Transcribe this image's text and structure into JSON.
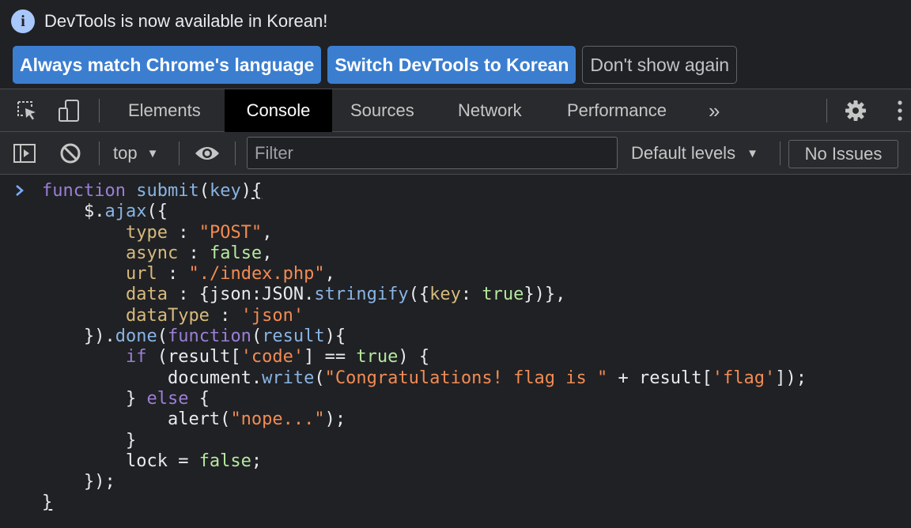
{
  "infobar": {
    "message": "DevTools is now available in Korean!",
    "buttons": {
      "match_language": "Always match Chrome's language",
      "switch_korean": "Switch DevTools to Korean",
      "dont_show": "Don't show again"
    }
  },
  "tabs": {
    "elements": "Elements",
    "console": "Console",
    "sources": "Sources",
    "network": "Network",
    "performance": "Performance",
    "more": "»"
  },
  "console_toolbar": {
    "context": "top",
    "filter_placeholder": "Filter",
    "levels": "Default levels",
    "issues": "No Issues"
  },
  "code": {
    "l1": {
      "kw": "function",
      "name": "submit",
      "open": "(",
      "param": "key",
      "close": ")",
      "brace": "{"
    },
    "l2": {
      "indent": "    ",
      "obj": "$.",
      "method": "ajax",
      "rest": "({"
    },
    "l3": {
      "indent": "        ",
      "key": "type",
      "sep": " : ",
      "value": "\"POST\"",
      "end": ","
    },
    "l4": {
      "indent": "        ",
      "key": "async",
      "sep": " : ",
      "value": "false",
      "end": ","
    },
    "l5": {
      "indent": "        ",
      "key": "url",
      "sep": " : ",
      "value": "\"./index.php\"",
      "end": ","
    },
    "l6": {
      "indent": "        ",
      "key": "data",
      "sep": " : {json:JSON.",
      "method": "stringify",
      "open": "({",
      "key2": "key",
      "colon": ": ",
      "value": "true",
      "end": "})},"
    },
    "l7": {
      "indent": "        ",
      "key": "dataType",
      "sep": " : ",
      "value": "'json'"
    },
    "l8": {
      "indent": "    ",
      "start": "}).",
      "method": "done",
      "open": "(",
      "kw": "function",
      "paren": "(",
      "param": "result",
      "end": "){"
    },
    "l9": {
      "indent": "        ",
      "kw": "if",
      "start": " (result[",
      "value": "'code'",
      "mid": "] == ",
      "lit": "true",
      "end": ") {"
    },
    "l10": {
      "indent": "            ",
      "obj": "document.",
      "method": "write",
      "open": "(",
      "value": "\"Congratulations! flag is \"",
      "mid": " + result[",
      "value2": "'flag'",
      "end": "]);"
    },
    "l11": {
      "indent": "        ",
      "start": "} ",
      "kw": "else",
      "end": " {"
    },
    "l12": {
      "indent": "            ",
      "start": "alert(",
      "value": "\"nope...\"",
      "end": ");"
    },
    "l13": {
      "indent": "        ",
      "text": "}"
    },
    "l14": {
      "indent": "        ",
      "start": "lock = ",
      "lit": "false",
      "end": ";"
    },
    "l15": {
      "indent": "    ",
      "text": "});"
    },
    "l16": {
      "text": "}"
    }
  },
  "colors": {
    "background": "#202124",
    "toolbar": "#292a2d",
    "primary_button": "#3b7ed0",
    "keyword": "#9a7fd6",
    "function": "#89b4e4",
    "property": "#d7ba7d",
    "string": "#f28b54",
    "literal": "#b5e8a0"
  },
  "icons": [
    "info-icon",
    "inspect-element-icon",
    "device-toolbar-icon",
    "more-tabs-icon",
    "settings-gear-icon",
    "kebab-menu-icon",
    "sidebar-toggle-icon",
    "clear-console-icon",
    "dropdown-caret-icon",
    "eye-icon",
    "console-prompt-icon"
  ]
}
